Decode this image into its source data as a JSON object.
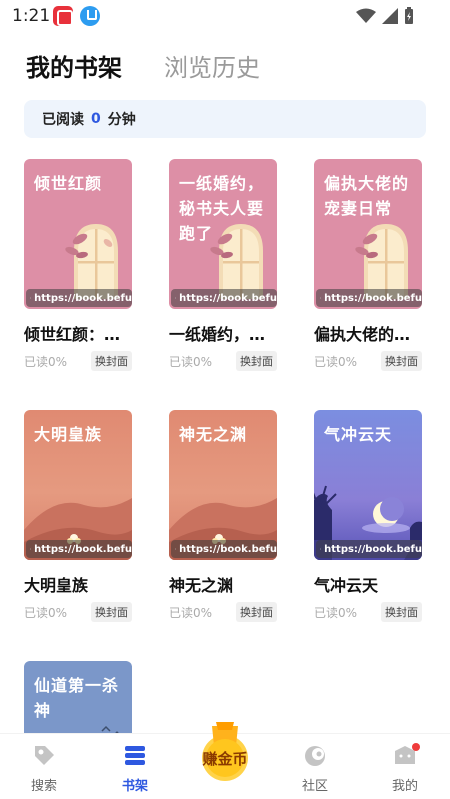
{
  "status": {
    "time": "1:21"
  },
  "tabs": {
    "bookshelf": "我的书架",
    "history": "浏览历史"
  },
  "reading": {
    "prefix": "已阅读",
    "minutes": "0",
    "suffix": "分钟"
  },
  "books": [
    {
      "cover_title": "倾世红颜",
      "name": "倾世红颜：…",
      "url": "https://book.befu",
      "progress": "已读0%",
      "change": "换封面"
    },
    {
      "cover_title": "一纸婚约，秘书夫人要跑了",
      "name": "一纸婚约，…",
      "url": "https://book.befu",
      "progress": "已读0%",
      "change": "换封面"
    },
    {
      "cover_title": "偏执大佬的宠妻日常",
      "name": "偏执大佬的…",
      "url": "https://book.befu",
      "progress": "已读0%",
      "change": "换封面"
    },
    {
      "cover_title": "大明皇族",
      "name": "大明皇族",
      "url": "https://book.befu",
      "progress": "已读0%",
      "change": "换封面"
    },
    {
      "cover_title": "神无之渊",
      "name": "神无之渊",
      "url": "https://book.befu",
      "progress": "已读0%",
      "change": "换封面"
    },
    {
      "cover_title": "气冲云天",
      "name": "气冲云天",
      "url": "https://book.befu",
      "progress": "已读0%",
      "change": "换封面"
    },
    {
      "cover_title": "仙道第一杀神"
    }
  ],
  "nav": {
    "search": "搜索",
    "shelf": "书架",
    "earn": "赚金币",
    "community": "社区",
    "mine": "我的"
  },
  "colors": {
    "accent": "#2e58e0",
    "pink_cover": "#dd8fa6"
  }
}
